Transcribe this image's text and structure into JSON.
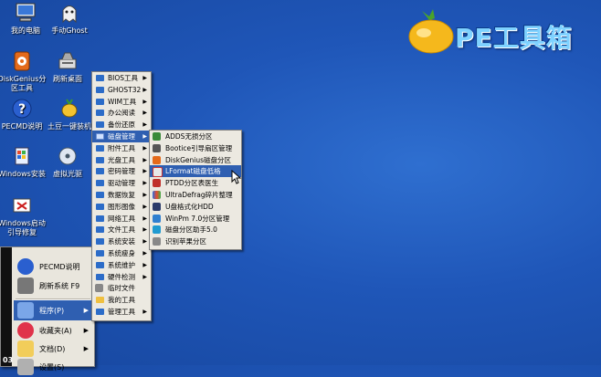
{
  "desktop_icons": [
    {
      "label": "我的电脑",
      "icon": "computer-icon"
    },
    {
      "label": "手动Ghost",
      "icon": "ghost-icon"
    },
    {
      "label": "DiskGenius分\n区工具",
      "icon": "diskgenius-icon"
    },
    {
      "label": "刷新桌面",
      "icon": "refresh-desktop-icon"
    },
    {
      "label": "PECMD说明",
      "icon": "help-icon"
    },
    {
      "label": "土豆一键装机",
      "icon": "potato-install-icon"
    },
    {
      "label": "Windows安装",
      "icon": "windows-install-icon"
    },
    {
      "label": "虚拟光驱",
      "icon": "virtual-drive-icon"
    },
    {
      "label": "Windows启动\n引导修复",
      "icon": "boot-repair-icon"
    }
  ],
  "logo": {
    "text": "PE工具箱"
  },
  "start_menu": {
    "side_text": "03",
    "items": [
      {
        "label": "PECMD说明",
        "icon": "help-icon"
      },
      {
        "label": "刷新系统 F9",
        "icon": "refresh-system-icon"
      },
      {
        "label": "程序(P)",
        "icon": "programs-icon"
      },
      {
        "label": "收藏夹(A)",
        "icon": "favorites-icon"
      },
      {
        "label": "文档(D)",
        "icon": "documents-icon"
      },
      {
        "label": "设置(S)",
        "icon": "settings-icon"
      }
    ]
  },
  "programs_menu": [
    {
      "label": "BIOS工具"
    },
    {
      "label": "GHOST32"
    },
    {
      "label": "WIM工具"
    },
    {
      "label": "办公阅读"
    },
    {
      "label": "备份还原"
    },
    {
      "label": "磁盘管理"
    },
    {
      "label": "附件工具"
    },
    {
      "label": "光盘工具"
    },
    {
      "label": "密码管理"
    },
    {
      "label": "驱动管理"
    },
    {
      "label": "数据恢复"
    },
    {
      "label": "图形图像"
    },
    {
      "label": "网络工具"
    },
    {
      "label": "文件工具"
    },
    {
      "label": "系统安装"
    },
    {
      "label": "系统瘦身"
    },
    {
      "label": "系统维护"
    },
    {
      "label": "硬件检测"
    },
    {
      "label": "临时文件"
    },
    {
      "label": "我的工具"
    },
    {
      "label": "管理工具"
    }
  ],
  "disk_menu": [
    {
      "label": "ADDS无损分区"
    },
    {
      "label": "Bootice引导扇区管理"
    },
    {
      "label": "DiskGenius磁盘分区"
    },
    {
      "label": "LFormat磁盘低格"
    },
    {
      "label": "PTDD分区表医生"
    },
    {
      "label": "UltraDefrag碎片整理"
    },
    {
      "label": "U盘格式化HDD"
    },
    {
      "label": "WinPm 7.0分区管理"
    },
    {
      "label": "磁盘分区助手5.0"
    },
    {
      "label": "识别苹果分区"
    }
  ],
  "colors": {
    "desktop": "#1f56b8",
    "menu_bg": "#ece9e1",
    "highlight": "#2f5fb1"
  }
}
